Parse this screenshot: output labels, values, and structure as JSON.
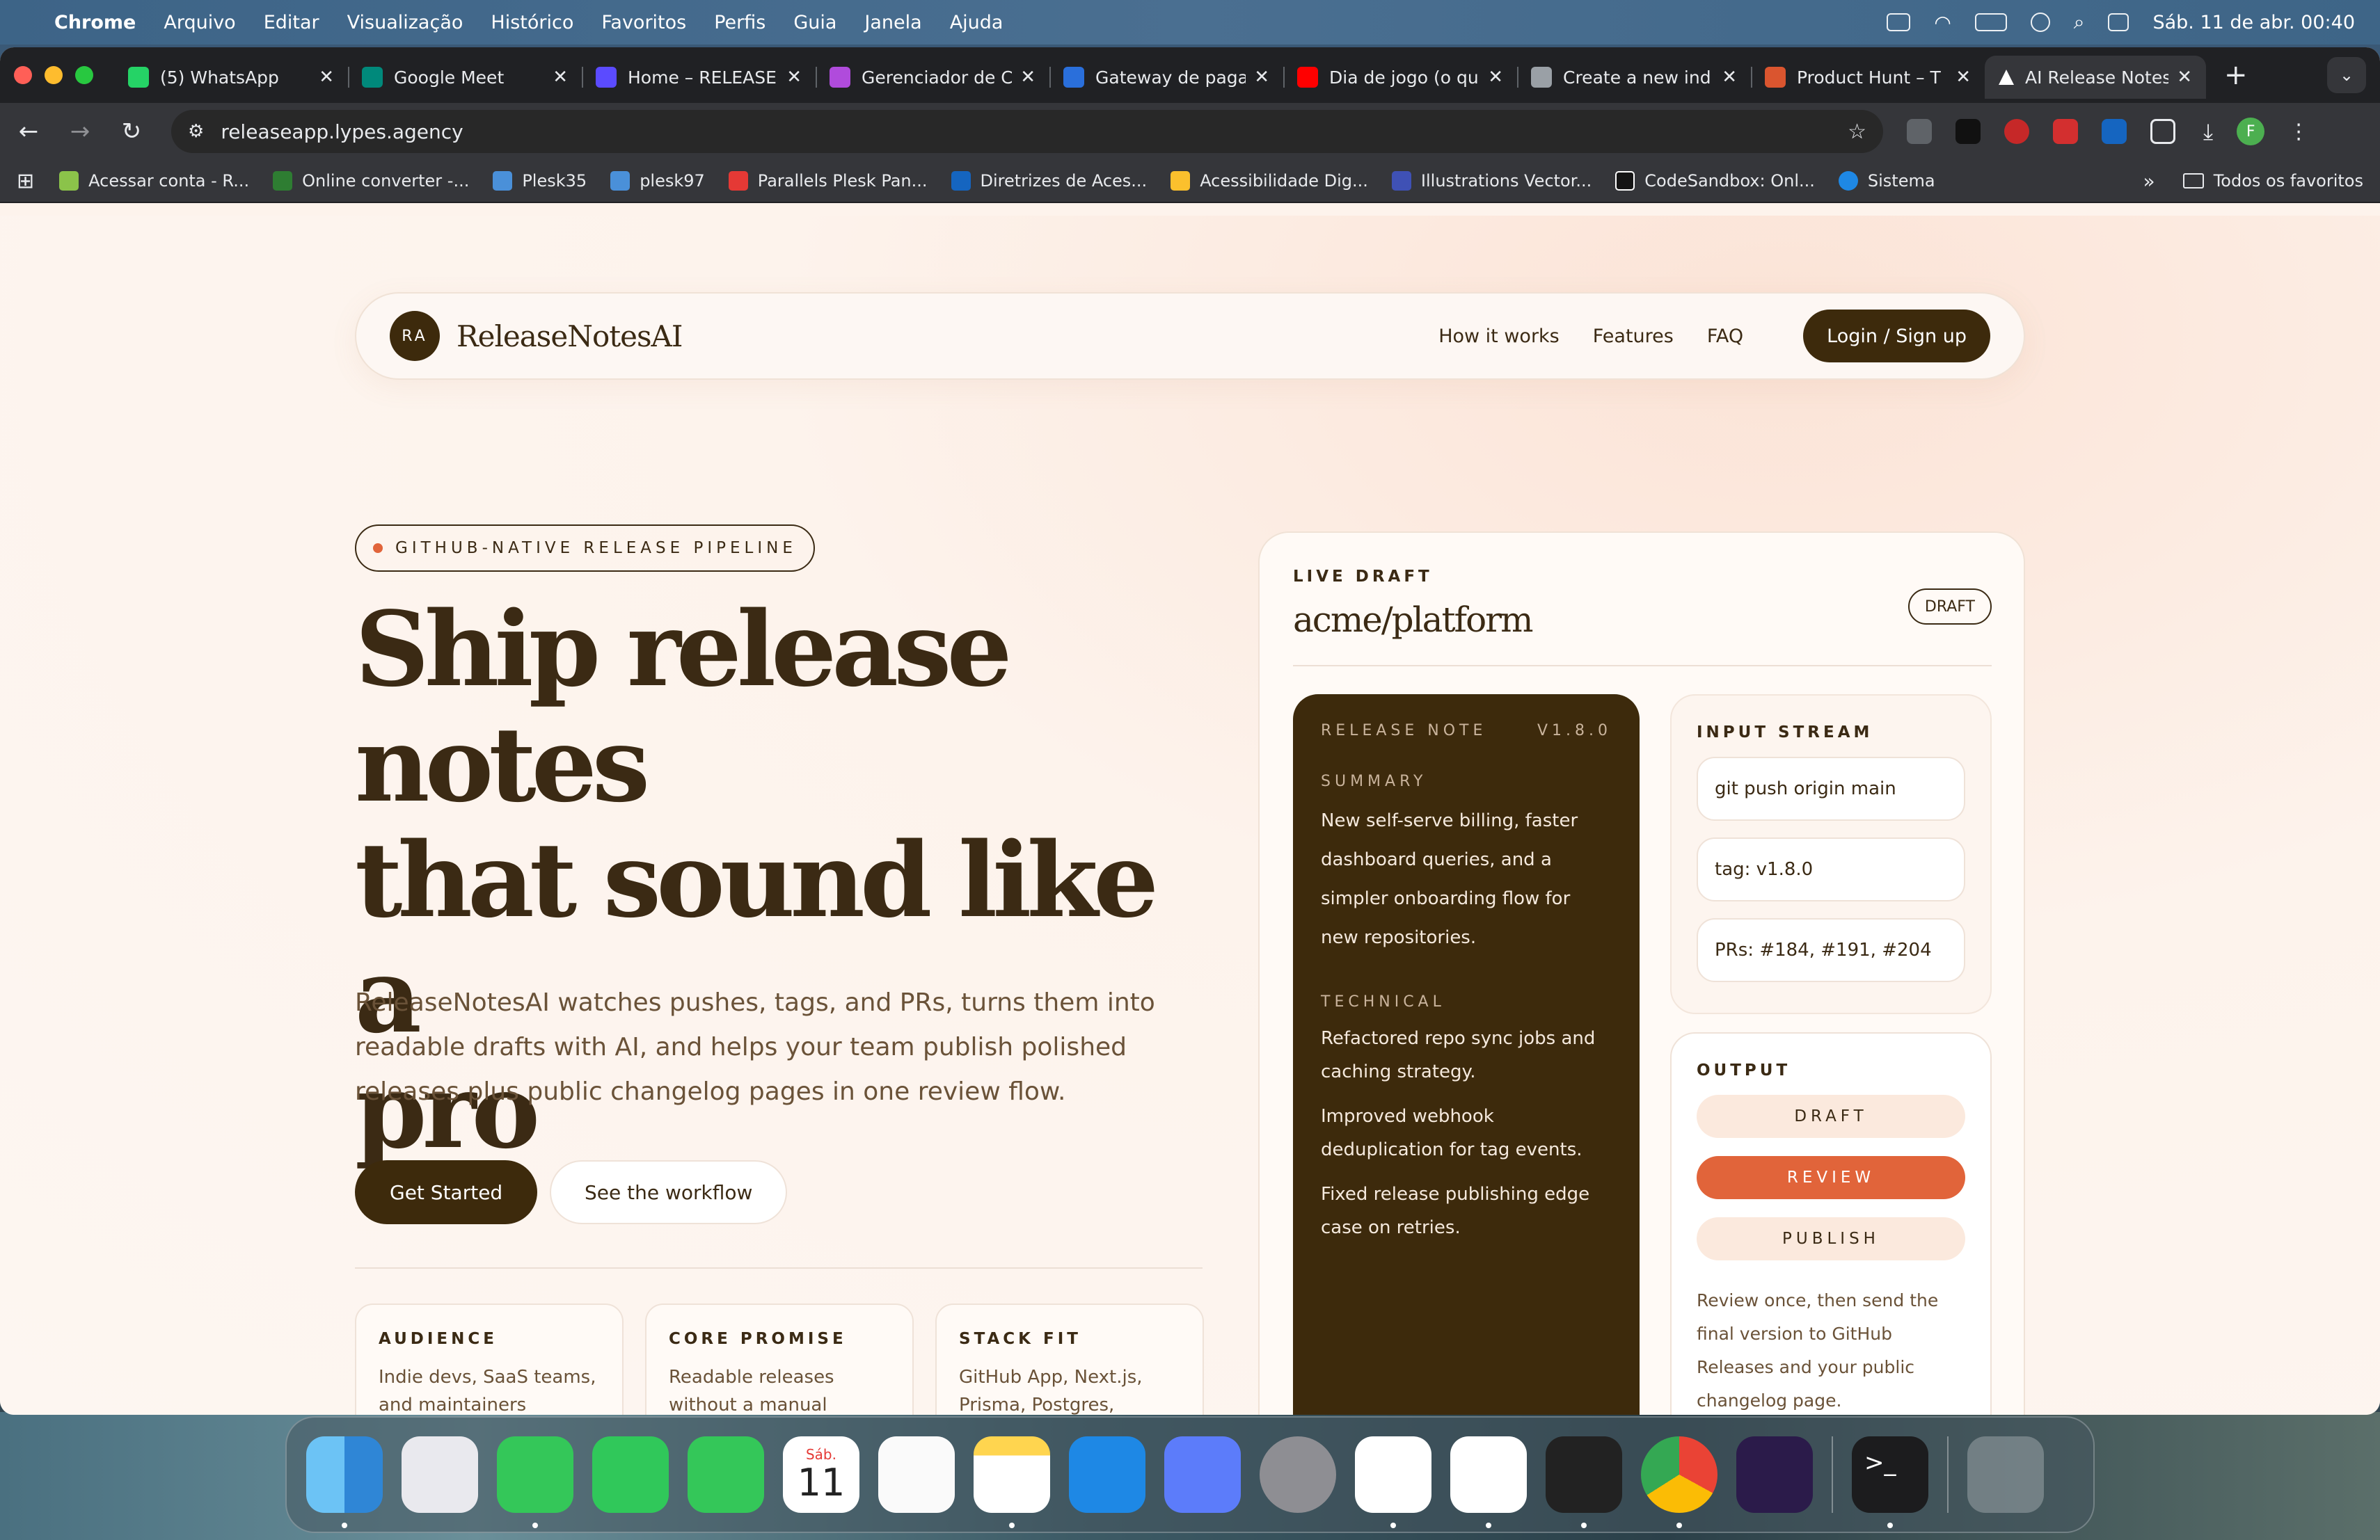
{
  "menubar": {
    "app": "Chrome",
    "items": [
      "Arquivo",
      "Editar",
      "Visualização",
      "Histórico",
      "Favoritos",
      "Perfis",
      "Guia",
      "Janela",
      "Ajuda"
    ],
    "clock": "Sáb. 11 de abr.  00:40"
  },
  "tabs": [
    {
      "label": "(5) WhatsApp",
      "color": "#25d366"
    },
    {
      "label": "Google Meet",
      "color": "#00897b"
    },
    {
      "label": "Home – RELEASE",
      "color": "#5b4bff"
    },
    {
      "label": "Gerenciador de C",
      "color": "#b04bdc"
    },
    {
      "label": "Gateway de paga",
      "color": "#2a6fdb"
    },
    {
      "label": "Dia de jogo (o qu",
      "color": "#ff0000"
    },
    {
      "label": "Create a new ind",
      "color": "#9aa0a6"
    },
    {
      "label": "Product Hunt – T",
      "color": "#da552f"
    },
    {
      "label": "AI Release Notes",
      "color": "#ffffff"
    }
  ],
  "address": {
    "url": "releaseapp.lypes.agency"
  },
  "bookmarks": [
    {
      "label": "Acessar conta - R...",
      "color": "#8bc34a"
    },
    {
      "label": "Online converter -...",
      "color": "#2e7d32"
    },
    {
      "label": "Plesk35",
      "color": "#4a90d9"
    },
    {
      "label": "plesk97",
      "color": "#4a90d9"
    },
    {
      "label": "Parallels Plesk Pan...",
      "color": "#e53935"
    },
    {
      "label": "Diretrizes de Aces...",
      "color": "#1565c0"
    },
    {
      "label": "Acessibilidade Dig...",
      "color": "#fbc02d"
    },
    {
      "label": "Illustrations Vector...",
      "color": "#3f51b5"
    },
    {
      "label": "CodeSandbox: Onl...",
      "color": "#151515"
    },
    {
      "label": "Sistema",
      "color": "#1e88e5"
    }
  ],
  "bookmarks_all": "Todos os favoritos",
  "site": {
    "logo_badge": "RA",
    "logo_text": "ReleaseNotesAI",
    "nav": [
      "How it works",
      "Features",
      "FAQ"
    ],
    "login": "Login / Sign up",
    "eyebrow": "GITHUB-NATIVE RELEASE PIPELINE",
    "title_lines": [
      "Ship release notes",
      "that sound like a",
      "pro"
    ],
    "subtitle": "ReleaseNotesAI watches pushes, tags, and PRs, turns them into readable drafts with AI, and helps your team publish polished releases plus public changelog pages in one review flow.",
    "cta_primary": "Get Started",
    "cta_secondary": "See the workflow",
    "cards": [
      {
        "title": "AUDIENCE",
        "body": "Indie devs, SaaS teams, and maintainers shipping on GitHub."
      },
      {
        "title": "CORE PROMISE",
        "body": "Readable releases without a manual copywriting pass every week."
      },
      {
        "title": "STACK FIT",
        "body": "GitHub App, Next.js, Prisma, Postgres, Fireworks AI."
      }
    ]
  },
  "draft": {
    "label": "LIVE DRAFT",
    "repo": "acme/platform",
    "badge": "DRAFT",
    "note_label": "RELEASE NOTE",
    "version": "V1.8.0",
    "summary_label": "SUMMARY",
    "summary": "New self-serve billing, faster dashboard queries, and a simpler onboarding flow for new repositories.",
    "technical_label": "TECHNICAL",
    "technical": [
      "Refactored repo sync jobs and caching strategy.",
      "Improved webhook deduplication for tag events.",
      "Fixed release publishing edge case on retries."
    ],
    "input_label": "INPUT STREAM",
    "inputs": [
      "git push origin main",
      "tag: v1.8.0",
      "PRs: #184, #191, #204"
    ],
    "output_label": "OUTPUT",
    "steps": [
      "DRAFT",
      "REVIEW",
      "PUBLISH"
    ],
    "active_step": "REVIEW",
    "output_text": "Review once, then send the final version to GitHub Releases and your public changelog page."
  },
  "dock": {
    "calendar_month": "Sáb.",
    "calendar_day": "11"
  },
  "colors": {
    "accent": "#e1643a",
    "brand_dark": "#3d2a0c",
    "page_bg": "#fdf3ec"
  }
}
